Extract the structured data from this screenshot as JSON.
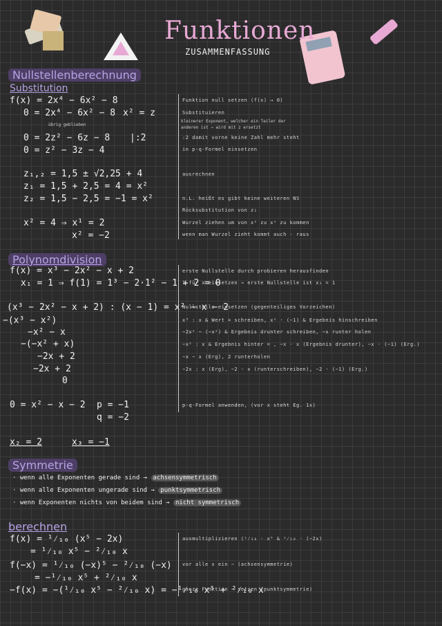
{
  "header": {
    "title": "Funktionen",
    "subtitle": "ZUSAMMENFASSUNG"
  },
  "sections": {
    "nullstellen": "Nullstellenberechnung",
    "substitution": "Substitution",
    "polynom": "Polynomdivision",
    "symmetrie": "Symmetrie",
    "berechnen": "berechnen"
  },
  "substitution": {
    "lines": [
      "f(x) = 2x⁴ − 6x² − 8",
      "0 = 2x⁴ − 6x² − 8",
      "0 = 2z² − 6z − 8",
      "0 = z² − 3z − 4",
      "z₁,₂ = 1,5 ± √2,25 + 4",
      "z₁ = 1,5 + 2,5 = 4 = x²",
      "z₂ = 1,5 − 2,5 = −1 = x²",
      "x² = 4 ⇒ x¹ = 2",
      "x² = −2"
    ],
    "xz": "x² = z",
    "divider": "|:2",
    "note_small": "übrig geblieben",
    "notes": [
      "Funktion null setzen (f(x) → 0)",
      "Substituieren",
      "kleinerer Exponent, welcher ein Teiler der",
      "anderen ist ⇒ wird mit z ersetzt",
      ":2 damit vorne keine Zahl mehr steht",
      "in p-q-Formel einsetzen",
      "ausrechnen",
      "n.L. heißt es gibt keine weiteren NS",
      "Rücksubstitution von z₁",
      "Wurzel ziehen um von x² zu x¹ zu kommen",
      "wenn man Wurzel zieht kommt auch - raus"
    ]
  },
  "polynom": {
    "lines": [
      "f(x) = x³ − 2x² − x + 2",
      "x₁ = 1 ⇒ f(1) = 1³ − 2·1² − 1 + 2 = 0",
      "(x³ − 2x² − x + 2) : (x − 1) = x² − x − 2",
      "−(x³ − x²)",
      "−x² − x",
      "−(−x² + x)",
      "−2x + 2",
      "−2x + 2",
      "0",
      "0 = x² − x − 2",
      "p = −1",
      "q = −2",
      "x₂ = 2",
      "x₃ = −1"
    ],
    "notes": [
      "erste Nullstelle durch probieren herausfinden",
      "1 für x einsetzen ⇒ erste Nullstelle ist x₁ = 1",
      "Nullstelle einsetzen (gegenteiliges Vorzeichen)",
      "x³ : x & Wert = schreiben, x² · (−1) & Ergebnis hinschreiben",
      "−2x² − (−x²) & Ergebnis drunter schreiben, −x runter holen",
      "−x² : x & Ergebnis hinter = , −x · x (Ergebnis drunter), −x · (−1) (Erg.)",
      "−x − x (Erg), 2 runterholen",
      "−2x : x (Erg), −2 · x (runterschreiben), −2 · (−1) (Erg.)",
      "p-q-Formel anwenden, (vor x steht Eg. 1x)"
    ]
  },
  "symmetrie": {
    "items": [
      {
        "text": "wenn alle Exponenten gerade sind",
        "result": "achsensymmetrisch"
      },
      {
        "text": "wenn alle Exponenten ungerade sind",
        "result": "punktsymmetrisch"
      },
      {
        "text": "wenn Exponenten nichts von beidem sind",
        "result": "nicht symmetrisch"
      }
    ]
  },
  "berechnen": {
    "lines": [
      "f(x) = ¹⁄₁₀ (x⁵ − 2x)",
      "= ¹⁄₁₀ x⁵ − ²⁄₁₀ x",
      "f(−x) = ¹⁄₁₀ (−x)⁵ − ²⁄₁₀ (−x)",
      "= −¹⁄₁₀ x⁵ + ²⁄₁₀ x",
      "−f(x) = −(¹⁄₁₀ x⁵ − ²⁄₁₀ x) = −¹⁄₁₀ x⁵ + ²⁄₁₀ x"
    ],
    "notes": [
      "ausmultiplizieren (¹⁄₁₀ · x⁵ & ¹⁄₁₀ · (−2x)",
      "vor alle x ein − (achsensymmetrie)",
      "ganze Funktion − setzen (punktsymmetrie)"
    ]
  },
  "colors": {
    "title": "#e7a9d4",
    "heading": "#b7a2e6",
    "bg": "#2b2b2b"
  }
}
